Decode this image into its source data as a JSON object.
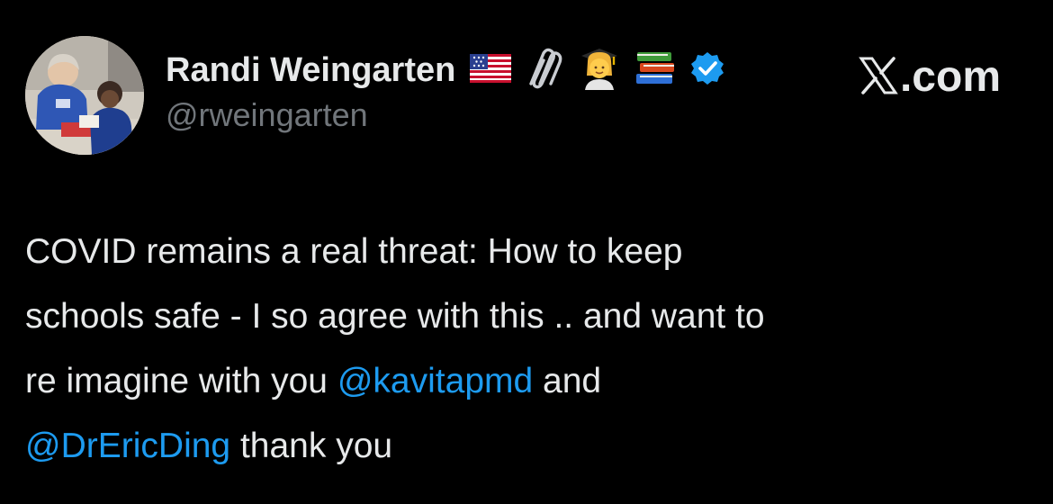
{
  "author": {
    "display_name": "Randi Weingarten",
    "handle": "@rweingarten",
    "avatar_icon": "profile-photo",
    "name_icons": [
      "us-flag-icon",
      "paperclip-icon",
      "teacher-icon",
      "books-icon",
      "verified-badge-icon"
    ],
    "verified_color": "#1d9bf0"
  },
  "brand": {
    "logo_icon": "x-logo-icon",
    "suffix_text": ".com"
  },
  "tweet": {
    "lines": [
      [
        {
          "text": "COVID remains a real threat: How to keep",
          "type": "text"
        }
      ],
      [
        {
          "text": "schools safe - I so agree with this .. and want to",
          "type": "text"
        }
      ],
      [
        {
          "text": "re imagine with you ",
          "type": "text"
        },
        {
          "text": "@kavitapmd",
          "type": "mention"
        },
        {
          "text": " and",
          "type": "text"
        }
      ],
      [
        {
          "text": "@DrEricDing",
          "type": "mention"
        },
        {
          "text": " thank you",
          "type": "text"
        }
      ]
    ]
  },
  "colors": {
    "background": "#000000",
    "text": "#e7e9ea",
    "secondary_text": "#71767b",
    "mention": "#1d9bf0"
  }
}
